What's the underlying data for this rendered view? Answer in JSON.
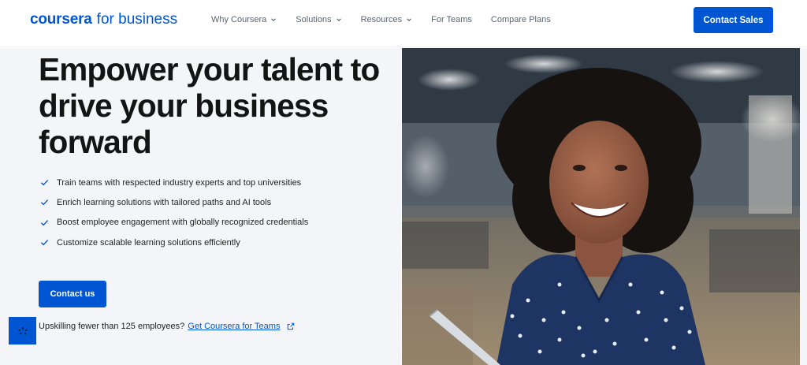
{
  "brand": {
    "name": "coursera",
    "suffix": "for business",
    "color": "#0056d2"
  },
  "nav": [
    {
      "label": "Why Coursera",
      "dropdown": true
    },
    {
      "label": "Solutions",
      "dropdown": true
    },
    {
      "label": "Resources",
      "dropdown": true
    },
    {
      "label": "For Teams",
      "dropdown": false
    },
    {
      "label": "Compare Plans",
      "dropdown": false
    }
  ],
  "header": {
    "cta_label": "Contact Sales"
  },
  "hero": {
    "headline": "Empower your talent to drive your business forward",
    "bullets": [
      "Train teams with respected industry experts and top universities",
      "Enrich learning solutions with tailored paths and AI tools",
      "Boost employee engagement with globally recognized credentials",
      "Customize scalable learning solutions efficiently"
    ],
    "cta_label": "Contact us",
    "teams_prompt": "Upskilling fewer than 125 employees?",
    "teams_link": "Get Coursera for Teams"
  },
  "icons": {
    "check": "check-icon",
    "external": "external-link-icon",
    "chevron": "chevron-down-icon",
    "chat": "chat-widget-icon"
  }
}
